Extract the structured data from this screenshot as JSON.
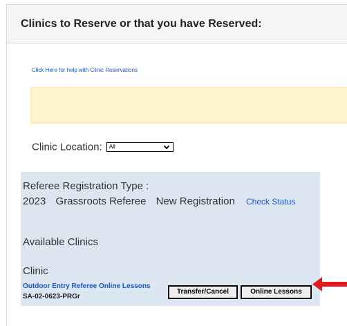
{
  "panel": {
    "title": "Clinics to Reserve or that you have Reserved:"
  },
  "help_link": "Click Here for help with Clinic Reservations",
  "location": {
    "label": "Clinic Location:",
    "selected": "All"
  },
  "registration": {
    "type_label": "Referee Registration Type :",
    "year": "2023",
    "grade": "Grassroots Referee",
    "status": "New Registration",
    "check_status_link": "Check Status"
  },
  "clinics": {
    "section_label": "Available Clinics",
    "column_label": "Clinic",
    "items": [
      {
        "name": "Outdoor Entry Referee Online Lessons",
        "code": "SA-02-0623-PRGr",
        "transfer_button": "Transfer/Cancel",
        "lessons_button": "Online Lessons"
      }
    ]
  },
  "colors": {
    "link": "#1a56c4",
    "notice_bg": "#fff3cd",
    "registration_bg": "#dce6f1",
    "arrow": "#e21b23"
  },
  "icons": {
    "dropdown": "chevron-down-icon",
    "pointer": "red-arrow-icon"
  }
}
